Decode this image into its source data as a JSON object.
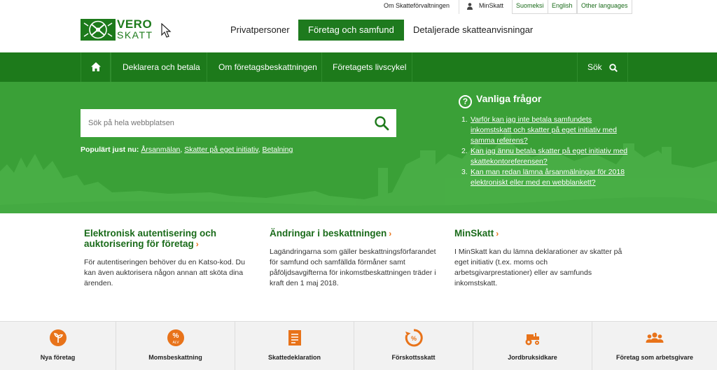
{
  "utility_bar": {
    "about": "Om Skatteförvaltningen",
    "minskatt": "MinSkatt",
    "languages": [
      "Suomeksi",
      "English",
      "Other languages"
    ]
  },
  "logo": {
    "line1": "VERO",
    "line2": "SKATT",
    "icon": "vero-crest-icon"
  },
  "main_nav": {
    "items": [
      {
        "label": "Privatpersoner",
        "active": false
      },
      {
        "label": "Företag och samfund",
        "active": true
      },
      {
        "label": "Detaljerade skatteanvisningar",
        "active": false
      }
    ]
  },
  "sub_nav": {
    "home_icon": "home-icon",
    "items": [
      "Deklarera och betala",
      "Om företagsbeskattningen",
      "Företagets livscykel"
    ],
    "search_label": "Sök"
  },
  "hero": {
    "search_placeholder": "Sök på hela webbplatsen",
    "popular_label": "Populärt just nu:",
    "popular_links": [
      "Årsanmälan",
      "Skatter på eget initiativ",
      "Betalning"
    ],
    "faq_title": "Vanliga frågor",
    "faq": [
      "Varför kan jag inte betala samfundets inkomstskatt och skatter på eget initiativ med samma referens?",
      "Kan jag ännu betala skatter på eget initiativ med skattekontoreferensen?",
      "Kan man redan lämna årsanmälningar för 2018 elektroniskt eller med en webblankett?"
    ]
  },
  "columns": [
    {
      "title": "Elektronisk autentisering och auktorisering för företag",
      "text": "För autentiseringen behöver du en Katso-kod. Du kan även auktorisera någon annan att sköta dina ärenden."
    },
    {
      "title": "Ändringar i beskattningen",
      "text": "Lagändringarna som gäller beskattningsförfarandet för samfund och samfällda förmåner samt påföljdsavgifterna för inkomstbeskattningen träder i kraft den 1 maj 2018."
    },
    {
      "title": "MinSkatt",
      "text": "I MinSkatt kan du lämna deklarationer av skatter på eget initiativ (t.ex. moms och arbetsgivarprestationer) eller av samfunds inkomstskatt."
    }
  ],
  "tiles": [
    {
      "label": "Nya företag",
      "icon": "coin-sprout-icon"
    },
    {
      "label": "Momsbeskattning",
      "icon": "percent-alv-icon"
    },
    {
      "label": "Skattedeklaration",
      "icon": "document-icon"
    },
    {
      "label": "Förskottsskatt",
      "icon": "percent-cycle-icon"
    },
    {
      "label": "Jordbruksidkare",
      "icon": "tractor-icon"
    },
    {
      "label": "Företag som arbetsgivare",
      "icon": "people-group-icon"
    }
  ],
  "colors": {
    "brand_green": "#1d7a1b",
    "hero_green": "#3aa037",
    "accent_orange": "#e8731a"
  }
}
